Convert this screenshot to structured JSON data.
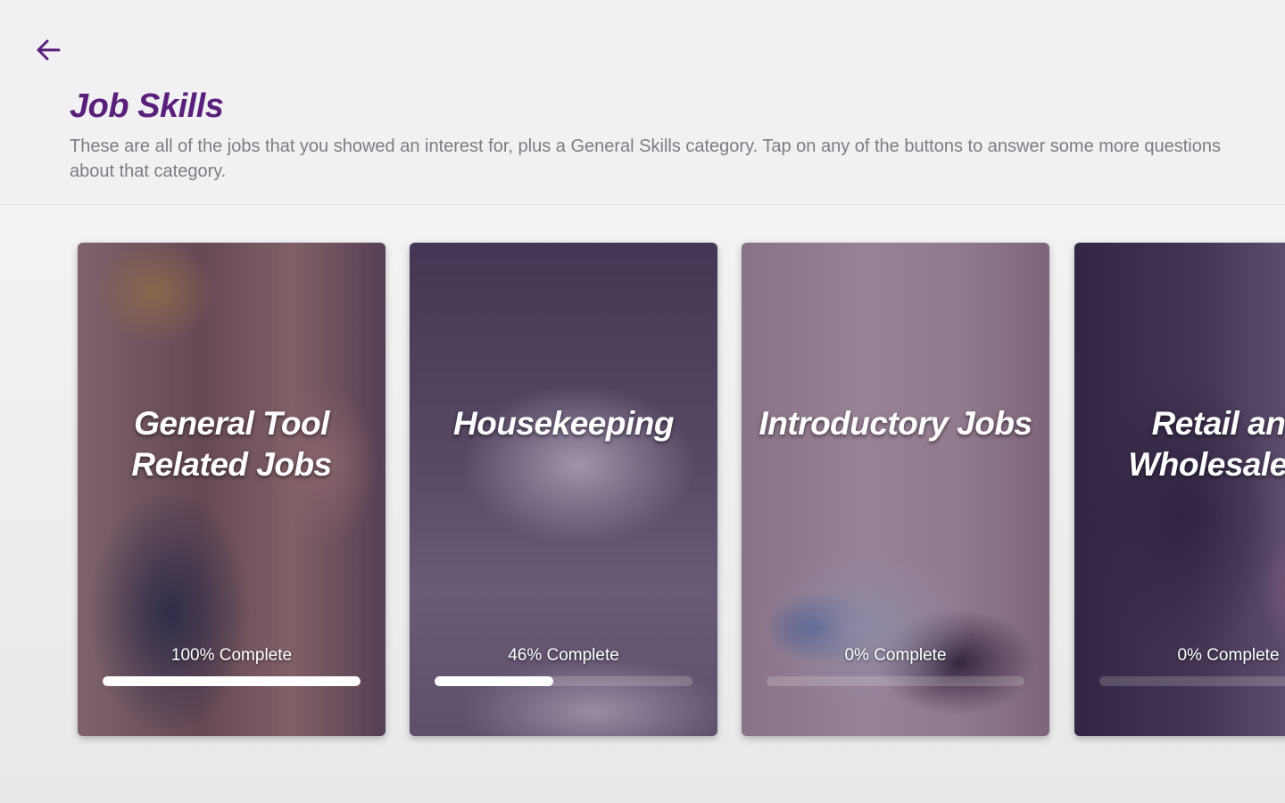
{
  "header": {
    "title": "Job Skills",
    "description": "These are all of the jobs that you showed an interest for, plus a General Skills category.  Tap on any of the buttons to answer some more questions about that category."
  },
  "cards": [
    {
      "title": "General Tool\nRelated Jobs",
      "progress_label": "100% Complete",
      "progress": 1.0
    },
    {
      "title": "Housekeeping",
      "progress_label": "46% Complete",
      "progress": 0.46
    },
    {
      "title": "Introductory Jobs",
      "progress_label": "0% Complete",
      "progress": 0.0
    },
    {
      "title": "Retail and\nWholesale St",
      "progress_label": "0% Complete",
      "progress": 0.0
    }
  ],
  "colors": {
    "accent": "#5a1f7a",
    "description_text": "#7c7c82",
    "card_overlay": "#3c1e50"
  },
  "icons": {
    "back": "arrow-left-icon"
  }
}
